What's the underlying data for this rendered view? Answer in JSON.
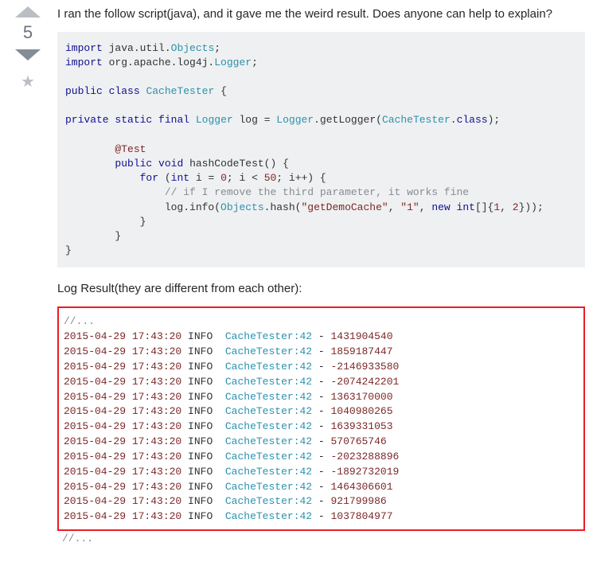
{
  "vote": {
    "count": "5"
  },
  "question": {
    "text": "I ran the follow script(java), and it gave me the weird result. Does anyone can help to explain?"
  },
  "code": {
    "l1a": "import",
    "l1b": " java.util.",
    "l1c": "Objects",
    "l1d": ";",
    "l2a": "import",
    "l2b": " org.apache.log4j.",
    "l2c": "Logger",
    "l2d": ";",
    "l3a": "public",
    "l3b": " ",
    "l3c": "class",
    "l3d": " ",
    "l3e": "CacheTester",
    "l3f": " {",
    "l4a": "private",
    "l4b": " ",
    "l4c": "static",
    "l4d": " ",
    "l4e": "final",
    "l4f": " ",
    "l4g": "Logger",
    "l4h": " log = ",
    "l4i": "Logger",
    "l4j": ".getLogger(",
    "l4k": "CacheTester",
    "l4l": ".",
    "l4m": "class",
    "l4n": ");",
    "l5a": "        @Test",
    "l6a": "        ",
    "l6b": "public",
    "l6c": " ",
    "l6d": "void",
    "l6e": " hashCodeTest() {",
    "l7a": "            ",
    "l7b": "for",
    "l7c": " (",
    "l7d": "int",
    "l7e": " i = ",
    "l7f": "0",
    "l7g": "; i < ",
    "l7h": "50",
    "l7i": "; i++) {",
    "l8a": "                ",
    "l8b": "// if I remove the third parameter, it works fine",
    "l9a": "                log.info(",
    "l9b": "Objects",
    "l9c": ".hash(",
    "l9d": "\"getDemoCache\"",
    "l9e": ", ",
    "l9f": "\"1\"",
    "l9g": ", ",
    "l9h": "new",
    "l9i": " ",
    "l9j": "int",
    "l9k": "[]{",
    "l9l": "1",
    "l9m": ", ",
    "l9n": "2",
    "l9o": "}));",
    "l10": "            }",
    "l11": "        }",
    "l12": "}"
  },
  "log_label": "Log Result(they are different from each other):",
  "log_comment": "//...",
  "logs": [
    {
      "ts": "2015-04-29 17:43:20",
      "lvl": "INFO",
      "cls": "CacheTester:42",
      "hash": "1431904540"
    },
    {
      "ts": "2015-04-29 17:43:20",
      "lvl": "INFO",
      "cls": "CacheTester:42",
      "hash": "1859187447"
    },
    {
      "ts": "2015-04-29 17:43:20",
      "lvl": "INFO",
      "cls": "CacheTester:42",
      "hash": "-2146933580"
    },
    {
      "ts": "2015-04-29 17:43:20",
      "lvl": "INFO",
      "cls": "CacheTester:42",
      "hash": "-2074242201"
    },
    {
      "ts": "2015-04-29 17:43:20",
      "lvl": "INFO",
      "cls": "CacheTester:42",
      "hash": "1363170000"
    },
    {
      "ts": "2015-04-29 17:43:20",
      "lvl": "INFO",
      "cls": "CacheTester:42",
      "hash": "1040980265"
    },
    {
      "ts": "2015-04-29 17:43:20",
      "lvl": "INFO",
      "cls": "CacheTester:42",
      "hash": "1639331053"
    },
    {
      "ts": "2015-04-29 17:43:20",
      "lvl": "INFO",
      "cls": "CacheTester:42",
      "hash": "570765746"
    },
    {
      "ts": "2015-04-29 17:43:20",
      "lvl": "INFO",
      "cls": "CacheTester:42",
      "hash": "-2023288896"
    },
    {
      "ts": "2015-04-29 17:43:20",
      "lvl": "INFO",
      "cls": "CacheTester:42",
      "hash": "-1892732019"
    },
    {
      "ts": "2015-04-29 17:43:20",
      "lvl": "INFO",
      "cls": "CacheTester:42",
      "hash": "1464306601"
    },
    {
      "ts": "2015-04-29 17:43:20",
      "lvl": "INFO",
      "cls": "CacheTester:42",
      "hash": "921799986"
    },
    {
      "ts": "2015-04-29 17:43:20",
      "lvl": "INFO",
      "cls": "CacheTester:42",
      "hash": "1037804977"
    }
  ],
  "log_trail": "//..."
}
